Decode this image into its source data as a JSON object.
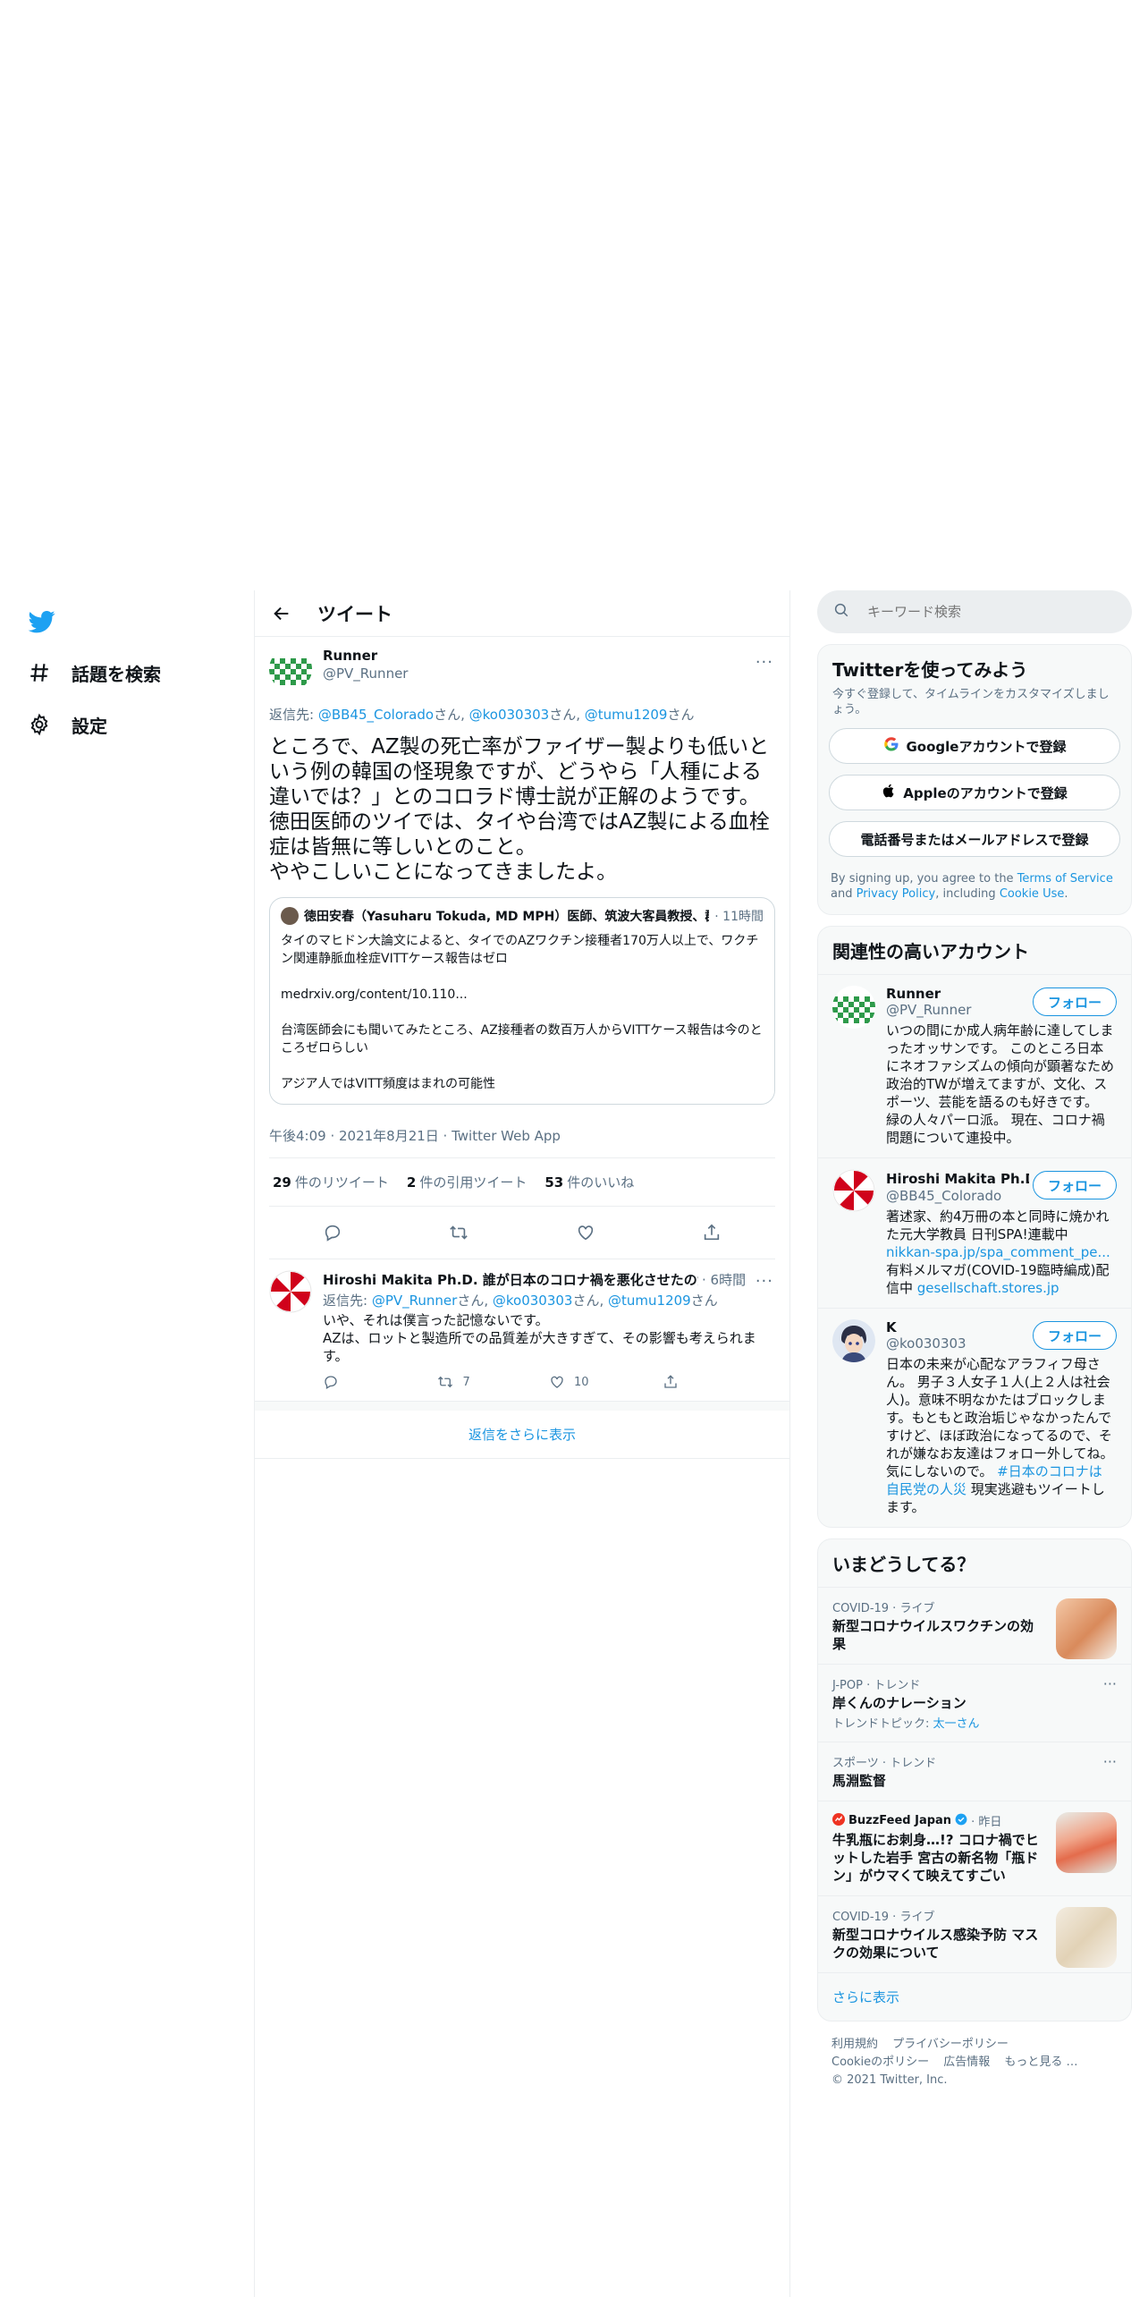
{
  "nav": {
    "explore_label": "話題を検索",
    "settings_label": "設定"
  },
  "header": {
    "title": "ツイート"
  },
  "tweet": {
    "author_name": "Runner",
    "author_handle": "@PV_Runner",
    "reply_prefix": "返信先: ",
    "reply_mentions": [
      "@BB45_Colorado",
      "@ko030303",
      "@tumu1209"
    ],
    "reply_san": "さん",
    "text": "ところで、AZ製の死亡率がファイザー製よりも低いという例の韓国の怪現象ですが、どうやら「人種による違いでは？」とのコロラド博士説が正解のようです。\n徳田医師のツイでは、タイや台湾ではAZ製による血栓症は皆無に等しいとのこと。\nややこしいことになってきましたよ。",
    "quote": {
      "name": "徳田安春（Yasuharu Tokuda, MD MPH）医師、筑波大客員教授、群馬大非常勤講師",
      "time": "· 11時間",
      "body": "タイのマヒドン大論文によると、タイでのAZワクチン接種者170万人以上で、ワクチン関連静脈血栓症VITTケース報告はゼロ\n\nmedrxiv.org/content/10.110...\n\n台湾医師会にも聞いてみたところ、AZ接種者の数百万人からVITTケース報告は今のところゼロらしい\n\nアジア人ではVITT頻度はまれの可能性"
    },
    "timestamp": "午後4:09 · 2021年8月21日 · Twitter Web App",
    "stats": {
      "retweets_count": "29",
      "retweets_label": "件のリツイート",
      "quotes_count": "2",
      "quotes_label": "件の引用ツイート",
      "likes_count": "53",
      "likes_label": "件のいいね"
    }
  },
  "reply": {
    "name": "Hiroshi Makita Ph.D. 誰が日本のコロナ禍を悪化させたのか・誰が日本を",
    "time": "· 6時間",
    "reply_prefix": "返信先: ",
    "mentions": [
      "@PV_Runner",
      "@ko030303",
      "@tumu1209"
    ],
    "san": "さん",
    "text": "いや、それは僕言った記憶ないです。\nAZは、ロットと製造所での品質差が大きすぎて、その影響も考えられます。",
    "retweets": "7",
    "likes": "10"
  },
  "show_more_replies": "返信をさらに表示",
  "search": {
    "placeholder": "キーワード検索"
  },
  "signup": {
    "title": "Twitterを使ってみよう",
    "subtitle": "今すぐ登録して、タイムラインをカスタマイズしましょう。",
    "google": "Googleアカウントで登録",
    "apple": "Appleのアカウントで登録",
    "phone": "電話番号またはメールアドレスで登録",
    "legal_1": "By signing up, you agree to the ",
    "terms": "Terms of Service",
    "legal_2": " and ",
    "privacy": "Privacy Policy",
    "legal_3": ", including ",
    "cookie": "Cookie Use",
    "legal_4": "."
  },
  "related": {
    "title": "関連性の高いアカウント",
    "follow_label": "フォロー",
    "accounts": [
      {
        "name": "Runner",
        "handle": "@PV_Runner",
        "bio": "いつの間にか成人病年齢に達してしまったオッサンです。 このところ日本にネオファシズムの傾向が顕著なため政治的TWが増えてますが、文化、スポーツ、芸能を語るのも好きです。 緑の人々パーロ派。 現在、コロナ禍問題について連投中。"
      },
      {
        "name": "Hiroshi Makita Ph.D. 誰",
        "handle": "@BB45_Colorado",
        "bio_1": "著述家、約4万冊の本と同時に焼かれた元大学教員 日刊SPA!連載中 ",
        "bio_link_1": "nikkan-spa.jp/spa_comment_pe...",
        "bio_2": " 有料メルマガ(COVID-19臨時編成)配信中 ",
        "bio_link_2": "gesellschaft.stores.jp"
      },
      {
        "name": "K",
        "handle": "@ko030303",
        "bio_1": "日本の未来が心配なアラフィフ母さん。 男子３人女子１人(上２人は社会人)。意味不明なかたはブロックします。もともと政治垢じゃなかったんですけど、ほぼ政治になってるので、それが嫌なお友達はフォロー外してね。気にしないので。 ",
        "bio_tag": "#日本のコロナは自民党の人災",
        "bio_2": " 現実逃避もツイートします。"
      }
    ]
  },
  "trends": {
    "title": "いまどうしてる？",
    "items": [
      {
        "meta": "COVID-19 · ライブ",
        "title": "新型コロナウイルスワクチンの効果"
      },
      {
        "meta": "J-POP · トレンド",
        "title": "岸くんのナレーション",
        "sub_prefix": "トレンドトピック: ",
        "sub_link": "太一さん"
      },
      {
        "meta": "スポーツ · トレンド",
        "title": "馬淵監督"
      },
      {
        "meta_source": "BuzzFeed Japan",
        "meta_time": " · 昨日",
        "title": "牛乳瓶にお刺身…!? コロナ禍でヒットした岩手 宮古の新名物「瓶ドン」がウマくて映えてすごい"
      },
      {
        "meta": "COVID-19 · ライブ",
        "title": "新型コロナウイルス感染予防 マスクの効果について"
      }
    ],
    "show_more": "さらに表示"
  },
  "footer": {
    "links": [
      "利用規約",
      "プライバシーポリシー",
      "Cookieのポリシー",
      "広告情報",
      "もっと見る …"
    ],
    "copyright": "© 2021 Twitter, Inc."
  },
  "colors": {
    "accent": "#1b95e0",
    "text": "#0f1419",
    "muted": "#5b7083",
    "border": "#ebeef0"
  }
}
